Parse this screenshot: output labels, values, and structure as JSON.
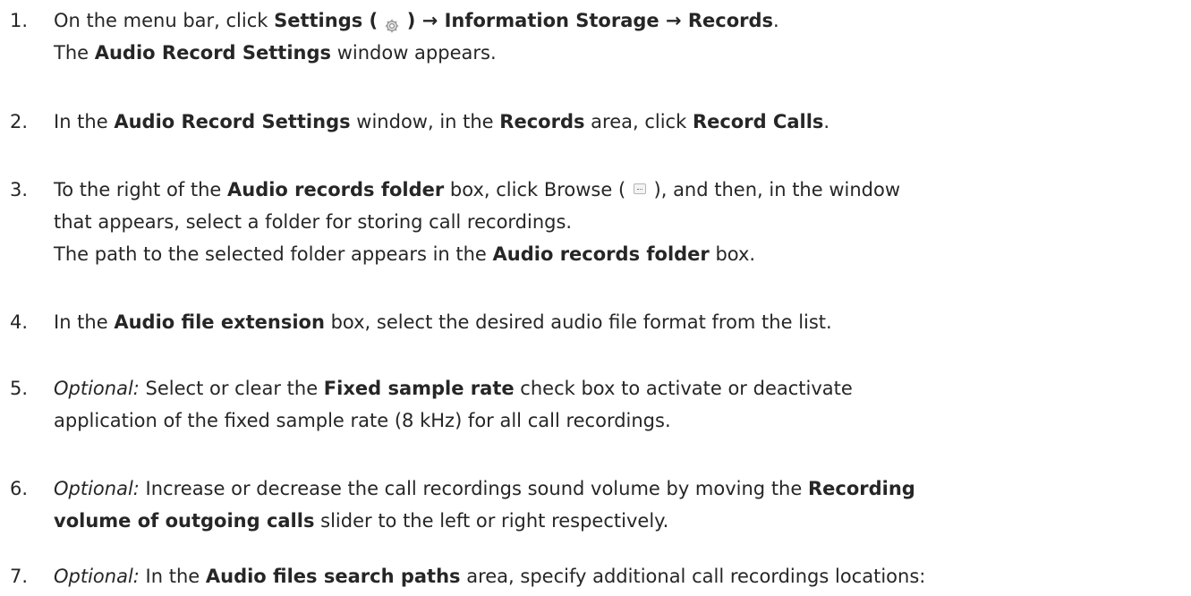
{
  "steps": [
    {
      "number": "1.",
      "line1": {
        "a": "On the menu bar, click ",
        "b": "Settings ( ",
        "icon": "gear-icon",
        "c": " ) → Information Storage → Records",
        "d": "."
      },
      "line2": {
        "a": "The ",
        "b": "Audio Record Settings",
        "c": " window appears."
      }
    },
    {
      "number": "2.",
      "a": "In the ",
      "b": "Audio Record Settings",
      "c": " window, in the ",
      "d": "Records",
      "e": " area, click ",
      "f": "Record Calls",
      "g": "."
    },
    {
      "number": "3.",
      "line1": {
        "a": "To the right of the ",
        "b": "Audio records folder",
        "c": " box, click Browse ( ",
        "icon": "browse-icon",
        "d": " ), and then, in the window"
      },
      "line2": "that appears, select a folder for storing call recordings.",
      "line3": {
        "a": "The path to the selected folder appears in the ",
        "b": "Audio records folder",
        "c": " box."
      }
    },
    {
      "number": "4.",
      "a": "In the ",
      "b": "Audio file extension",
      "c": " box, select the desired audio file format from the list."
    },
    {
      "number": "5.",
      "line1": {
        "a": "Optional:",
        "b": " Select or clear the ",
        "c": "Fixed sample rate",
        "d": " check box to activate or deactivate"
      },
      "line2": "application of the fixed sample rate (8 kHz) for all call recordings."
    },
    {
      "number": "6.",
      "line1": {
        "a": "Optional:",
        "b": " Increase or decrease the call recordings sound volume by moving the ",
        "c": "Recording"
      },
      "line2": {
        "a": "volume of outgoing calls",
        "b": " slider to the left or right respectively."
      }
    },
    {
      "number": "7.",
      "a": "Optional:",
      "b": " In the ",
      "c": "Audio files search paths",
      "d": " area, specify additional call recordings locations:"
    }
  ]
}
